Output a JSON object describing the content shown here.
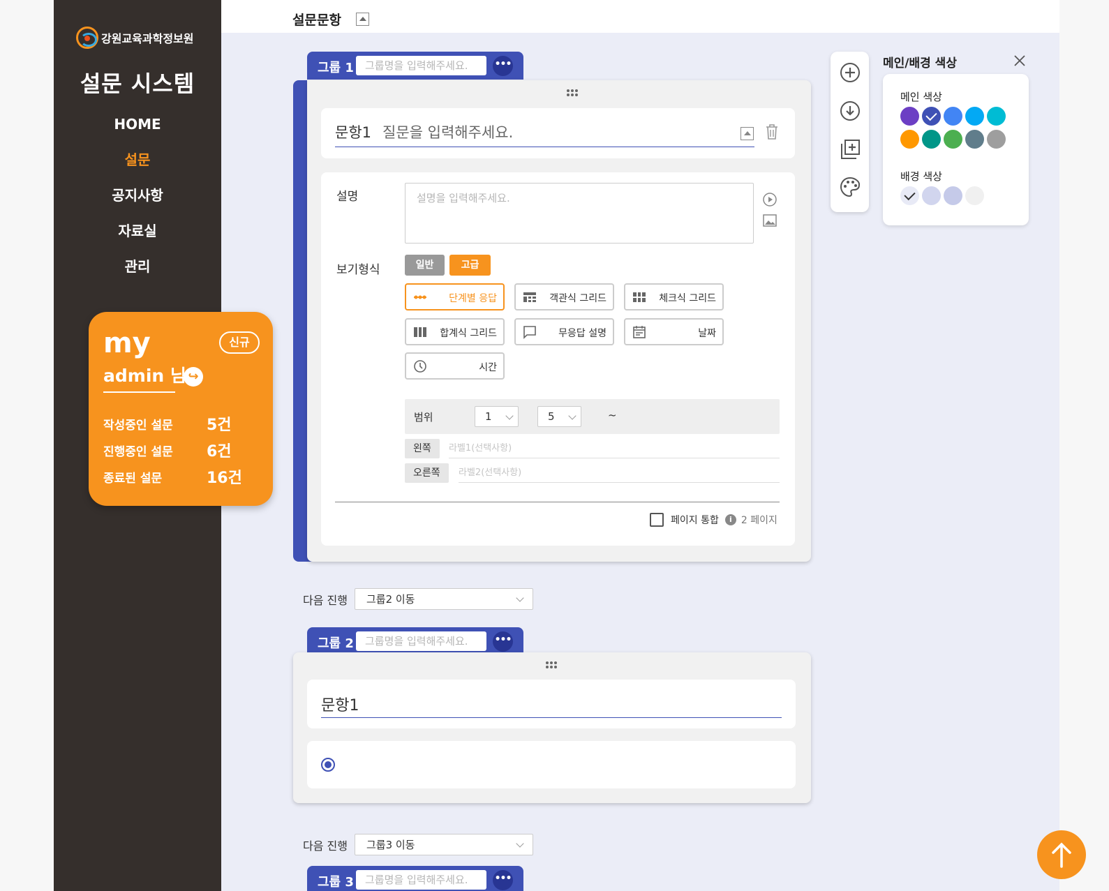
{
  "header": {
    "title": "설문문항"
  },
  "sidebar": {
    "org_name": "강원교육과학정보원",
    "system_title": "설문 시스템",
    "nav": [
      {
        "label": "HOME",
        "active": false
      },
      {
        "label": "설문",
        "active": true
      },
      {
        "label": "공지사항",
        "active": false
      },
      {
        "label": "자료실",
        "active": false
      },
      {
        "label": "관리",
        "active": false
      }
    ]
  },
  "my_card": {
    "title": "my",
    "new_label": "신규",
    "user": "admin 님",
    "stats": [
      {
        "label": "작성중인 설문",
        "count": "5건"
      },
      {
        "label": "진행중인 설문",
        "count": "6건"
      },
      {
        "label": "종료된 설문",
        "count": "16건"
      }
    ]
  },
  "groups": [
    {
      "label": "그룹 1",
      "placeholder": "그룹명을 입력해주세요."
    },
    {
      "label": "그룹 2",
      "placeholder": "그룹명을 입력해주세요."
    },
    {
      "label": "그룹 3",
      "placeholder": "그룹명을 입력해주세요."
    }
  ],
  "question1": {
    "number": "문항1",
    "placeholder": "질문을 입력해주세요.",
    "desc_label": "설명",
    "desc_placeholder": "설명을 입력해주세요.",
    "view_label": "보기형식",
    "modes": {
      "normal": "일반",
      "advanced": "고급"
    },
    "types": [
      {
        "label": "단계별 응답",
        "icon": "dots-line-icon",
        "selected": true
      },
      {
        "label": "객관식 그리드",
        "icon": "grid-icon",
        "selected": false
      },
      {
        "label": "체크식 그리드",
        "icon": "check-grid-icon",
        "selected": false
      },
      {
        "label": "합계식 그리드",
        "icon": "sum-grid-icon",
        "selected": false
      },
      {
        "label": "무응답 설명",
        "icon": "speech-bubble-icon",
        "selected": false
      },
      {
        "label": "날짜",
        "icon": "calendar-icon",
        "selected": false
      },
      {
        "label": "시간",
        "icon": "clock-icon",
        "selected": false
      }
    ],
    "range": {
      "label": "범위",
      "min": "1",
      "sep": "~",
      "max": "5"
    },
    "left_label": "왼쪽",
    "left_placeholder": "라벨1(선택사항)",
    "right_label": "오른쪽",
    "right_placeholder": "라벨2(선택사항)",
    "page_merge_label": "페이지 통합",
    "page_count": "2 페이지"
  },
  "next1": {
    "label": "다음 진행",
    "value": "그룹2 이동"
  },
  "question2": {
    "number": "문항1"
  },
  "next2": {
    "label": "다음 진행",
    "value": "그룹3 이동"
  },
  "color_panel": {
    "title": "메인/배경 색상",
    "main_label": "메인 색상",
    "bg_label": "배경 색상",
    "main_colors": [
      "#6c3fc4",
      "#3f51b5",
      "#4285f4",
      "#03a9f4",
      "#00bcd4",
      "#ff9800",
      "#009688",
      "#4caf50",
      "#607d8b",
      "#9e9e9e"
    ],
    "main_selected": 1,
    "bg_colors": [
      "#e8eaf6",
      "#d1d5ee",
      "#c5cae9",
      "#f0f0f0"
    ],
    "bg_selected": 0
  },
  "colors": {
    "primary": "#3f51b5",
    "accent": "#f7931e",
    "sidebar": "#352f2c"
  }
}
